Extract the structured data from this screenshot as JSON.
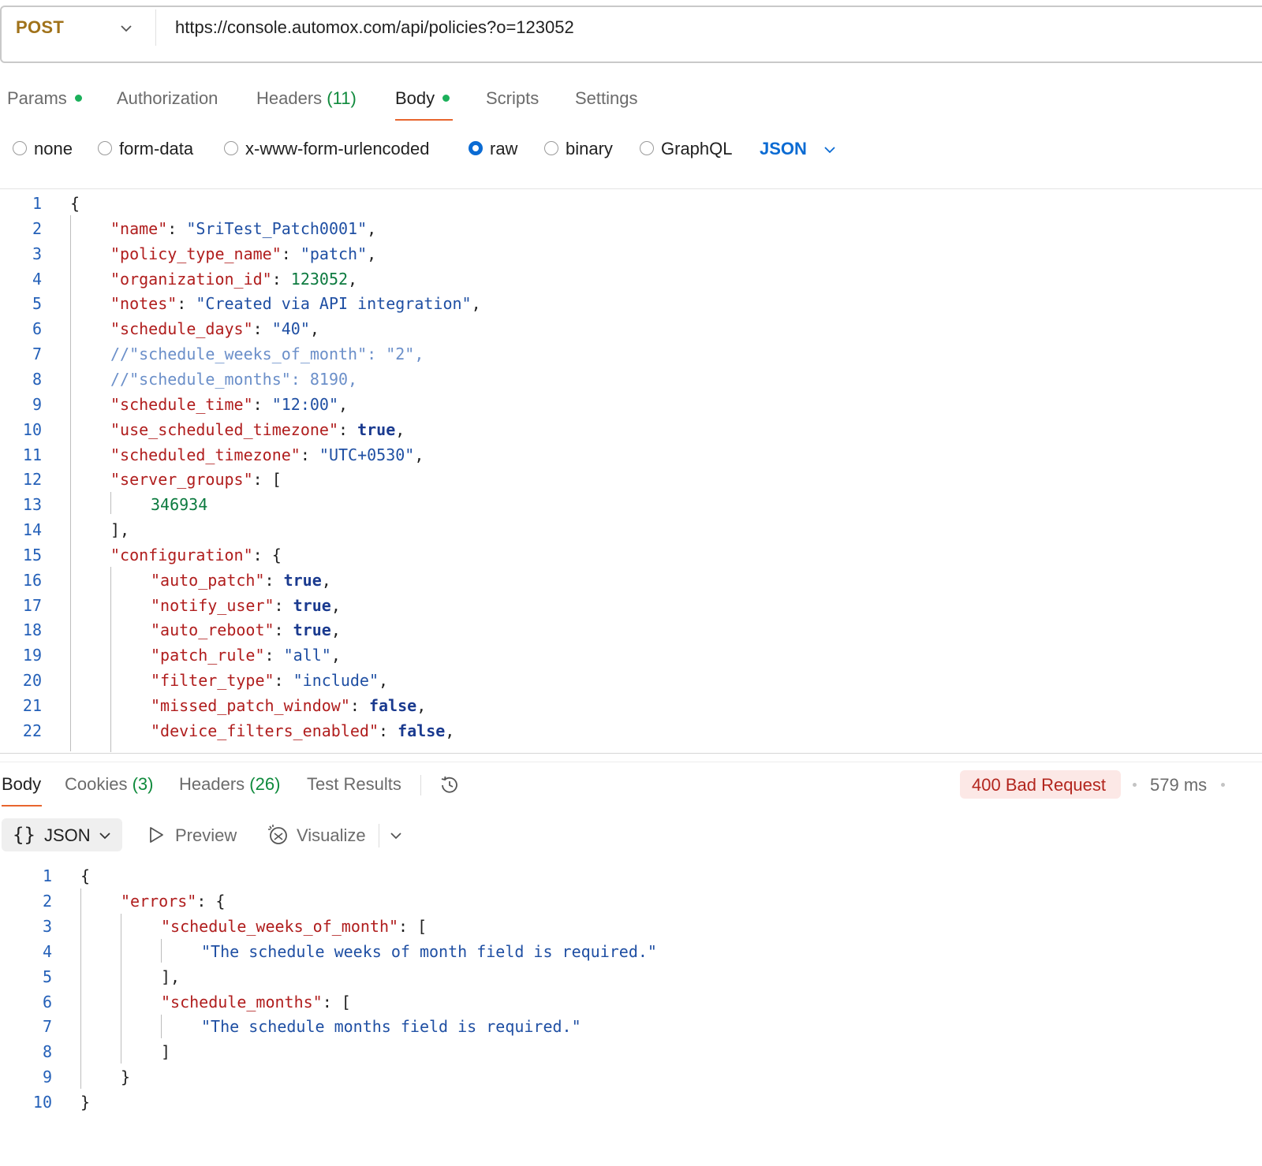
{
  "request": {
    "method": "POST",
    "url": "https://console.automox.com/api/policies?o=123052"
  },
  "request_tabs": [
    {
      "label": "Params",
      "count": "",
      "dot": true
    },
    {
      "label": "Authorization",
      "count": "",
      "dot": false
    },
    {
      "label": "Headers",
      "count": "(11)",
      "dot": false
    },
    {
      "label": "Body",
      "count": "",
      "dot": true
    },
    {
      "label": "Scripts",
      "count": "",
      "dot": false
    },
    {
      "label": "Settings",
      "count": "",
      "dot": false
    }
  ],
  "body_types": [
    {
      "label": "none",
      "selected": false
    },
    {
      "label": "form-data",
      "selected": false
    },
    {
      "label": "x-www-form-urlencoded",
      "selected": false
    },
    {
      "label": "raw",
      "selected": true
    },
    {
      "label": "binary",
      "selected": false
    },
    {
      "label": "GraphQL",
      "selected": false
    }
  ],
  "body_format": "JSON",
  "request_code": [
    {
      "n": "1",
      "indent": 0,
      "toks": [
        [
          "p",
          "{"
        ]
      ]
    },
    {
      "n": "2",
      "indent": 1,
      "toks": [
        [
          "k",
          "\"name\""
        ],
        [
          "p",
          ": "
        ],
        [
          "s",
          "\"SriTest_Patch0001\""
        ],
        [
          "p",
          ","
        ]
      ]
    },
    {
      "n": "3",
      "indent": 1,
      "toks": [
        [
          "k",
          "\"policy_type_name\""
        ],
        [
          "p",
          ": "
        ],
        [
          "s",
          "\"patch\""
        ],
        [
          "p",
          ","
        ]
      ]
    },
    {
      "n": "4",
      "indent": 1,
      "toks": [
        [
          "k",
          "\"organization_id\""
        ],
        [
          "p",
          ": "
        ],
        [
          "n",
          "123052"
        ],
        [
          "p",
          ","
        ]
      ]
    },
    {
      "n": "5",
      "indent": 1,
      "toks": [
        [
          "k",
          "\"notes\""
        ],
        [
          "p",
          ": "
        ],
        [
          "s",
          "\"Created via API integration\""
        ],
        [
          "p",
          ","
        ]
      ]
    },
    {
      "n": "6",
      "indent": 1,
      "toks": [
        [
          "k",
          "\"schedule_days\""
        ],
        [
          "p",
          ": "
        ],
        [
          "s",
          "\"40\""
        ],
        [
          "p",
          ","
        ]
      ]
    },
    {
      "n": "7",
      "indent": 1,
      "toks": [
        [
          "c",
          "//\"schedule_weeks_of_month\": \"2\","
        ]
      ]
    },
    {
      "n": "8",
      "indent": 1,
      "toks": [
        [
          "c",
          "//\"schedule_months\": 8190,"
        ]
      ]
    },
    {
      "n": "9",
      "indent": 1,
      "toks": [
        [
          "k",
          "\"schedule_time\""
        ],
        [
          "p",
          ": "
        ],
        [
          "s",
          "\"12:00\""
        ],
        [
          "p",
          ","
        ]
      ]
    },
    {
      "n": "10",
      "indent": 1,
      "toks": [
        [
          "k",
          "\"use_scheduled_timezone\""
        ],
        [
          "p",
          ": "
        ],
        [
          "b",
          "true"
        ],
        [
          "p",
          ","
        ]
      ]
    },
    {
      "n": "11",
      "indent": 1,
      "toks": [
        [
          "k",
          "\"scheduled_timezone\""
        ],
        [
          "p",
          ": "
        ],
        [
          "s",
          "\"UTC+0530\""
        ],
        [
          "p",
          ","
        ]
      ]
    },
    {
      "n": "12",
      "indent": 1,
      "toks": [
        [
          "k",
          "\"server_groups\""
        ],
        [
          "p",
          ": ["
        ]
      ]
    },
    {
      "n": "13",
      "indent": 2,
      "toks": [
        [
          "n",
          "346934"
        ]
      ]
    },
    {
      "n": "14",
      "indent": 1,
      "toks": [
        [
          "p",
          "],"
        ]
      ]
    },
    {
      "n": "15",
      "indent": 1,
      "toks": [
        [
          "k",
          "\"configuration\""
        ],
        [
          "p",
          ": {"
        ]
      ]
    },
    {
      "n": "16",
      "indent": 2,
      "toks": [
        [
          "k",
          "\"auto_patch\""
        ],
        [
          "p",
          ": "
        ],
        [
          "b",
          "true"
        ],
        [
          "p",
          ","
        ]
      ]
    },
    {
      "n": "17",
      "indent": 2,
      "toks": [
        [
          "k",
          "\"notify_user\""
        ],
        [
          "p",
          ": "
        ],
        [
          "b",
          "true"
        ],
        [
          "p",
          ","
        ]
      ]
    },
    {
      "n": "18",
      "indent": 2,
      "toks": [
        [
          "k",
          "\"auto_reboot\""
        ],
        [
          "p",
          ": "
        ],
        [
          "b",
          "true"
        ],
        [
          "p",
          ","
        ]
      ]
    },
    {
      "n": "19",
      "indent": 2,
      "toks": [
        [
          "k",
          "\"patch_rule\""
        ],
        [
          "p",
          ": "
        ],
        [
          "s",
          "\"all\""
        ],
        [
          "p",
          ","
        ]
      ]
    },
    {
      "n": "20",
      "indent": 2,
      "toks": [
        [
          "k",
          "\"filter_type\""
        ],
        [
          "p",
          ": "
        ],
        [
          "s",
          "\"include\""
        ],
        [
          "p",
          ","
        ]
      ]
    },
    {
      "n": "21",
      "indent": 2,
      "toks": [
        [
          "k",
          "\"missed_patch_window\""
        ],
        [
          "p",
          ": "
        ],
        [
          "b",
          "false"
        ],
        [
          "p",
          ","
        ]
      ]
    },
    {
      "n": "22",
      "indent": 2,
      "toks": [
        [
          "k",
          "\"device_filters_enabled\""
        ],
        [
          "p",
          ": "
        ],
        [
          "b",
          "false"
        ],
        [
          "p",
          ","
        ]
      ]
    }
  ],
  "response_tabs": [
    {
      "label": "Body",
      "count": ""
    },
    {
      "label": "Cookies",
      "count": "(3)"
    },
    {
      "label": "Headers",
      "count": "(26)"
    },
    {
      "label": "Test Results",
      "count": ""
    }
  ],
  "response_status": "400 Bad Request",
  "response_time": "579 ms",
  "response_format": "JSON",
  "response_format_braces": "{}",
  "response_tools": {
    "preview": "Preview",
    "visualize": "Visualize"
  },
  "response_code": [
    {
      "n": "1",
      "indent": 0,
      "toks": [
        [
          "p",
          "{"
        ]
      ]
    },
    {
      "n": "2",
      "indent": 1,
      "toks": [
        [
          "k",
          "\"errors\""
        ],
        [
          "p",
          ": {"
        ]
      ]
    },
    {
      "n": "3",
      "indent": 2,
      "toks": [
        [
          "k",
          "\"schedule_weeks_of_month\""
        ],
        [
          "p",
          ": ["
        ]
      ]
    },
    {
      "n": "4",
      "indent": 3,
      "toks": [
        [
          "s",
          "\"The schedule weeks of month field is required.\""
        ]
      ]
    },
    {
      "n": "5",
      "indent": 2,
      "toks": [
        [
          "p",
          "],"
        ]
      ]
    },
    {
      "n": "6",
      "indent": 2,
      "toks": [
        [
          "k",
          "\"schedule_months\""
        ],
        [
          "p",
          ": ["
        ]
      ]
    },
    {
      "n": "7",
      "indent": 3,
      "toks": [
        [
          "s",
          "\"The schedule months field is required.\""
        ]
      ]
    },
    {
      "n": "8",
      "indent": 2,
      "toks": [
        [
          "p",
          "]"
        ]
      ]
    },
    {
      "n": "9",
      "indent": 1,
      "toks": [
        [
          "p",
          "}"
        ]
      ]
    },
    {
      "n": "10",
      "indent": 0,
      "toks": [
        [
          "p",
          "}"
        ]
      ]
    }
  ]
}
